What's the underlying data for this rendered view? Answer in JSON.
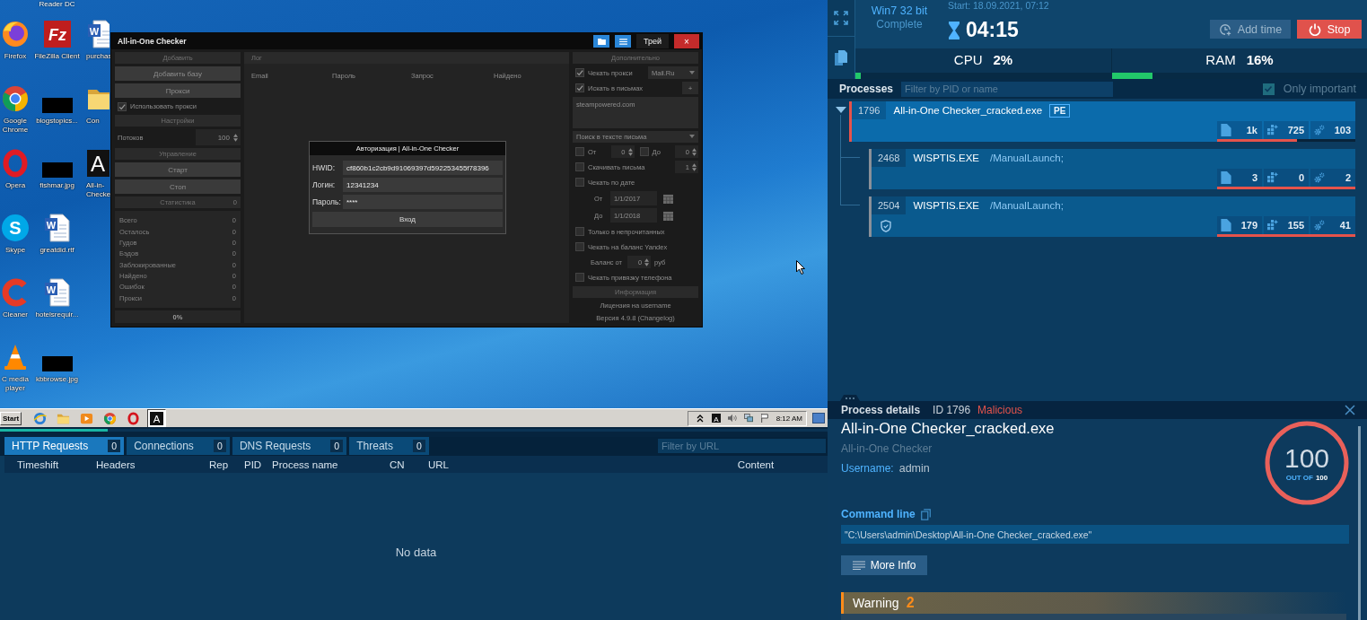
{
  "desktop": {
    "top_caption": "Reader DC",
    "columns": [
      [
        {
          "kind": "firefox",
          "lines": [
            "Firefox"
          ]
        },
        {
          "kind": "chrome",
          "lines": [
            "Google",
            "Chrome"
          ]
        },
        {
          "kind": "opera",
          "lines": [
            "Opera"
          ]
        },
        {
          "kind": "skype",
          "glyph": "S",
          "lines": [
            "Skype"
          ]
        },
        {
          "kind": "ccleaner",
          "lines": [
            "Cleaner"
          ]
        },
        {
          "kind": "vlc",
          "lines": [
            "C media",
            "player"
          ]
        }
      ],
      [
        {
          "kind": "filezilla",
          "glyph": "Fz",
          "lines": [
            "FileZilla Client"
          ]
        },
        {
          "kind": "redacted",
          "lines": [
            "blogstopics..."
          ]
        },
        {
          "kind": "redacted",
          "lines": [
            "fishmar.jpg"
          ]
        },
        {
          "kind": "word",
          "glyph": "W",
          "lines": [
            "greatdid.rtf"
          ]
        },
        {
          "kind": "word",
          "glyph": "W",
          "lines": [
            "hotelsrequir..."
          ]
        },
        {
          "kind": "redacted",
          "lines": [
            "kbbrowse.jpg"
          ]
        }
      ],
      [
        {
          "kind": "word",
          "glyph": "W",
          "lines": [
            "purchas"
          ]
        },
        {
          "kind": "folder",
          "lines": [
            "Con"
          ]
        },
        {
          "kind": "app",
          "glyph": "A",
          "lines": [
            "All-in-",
            "Checke"
          ]
        }
      ]
    ]
  },
  "checker_window": {
    "title": "All-in-One Checker",
    "title_buttons": [
      {
        "kind": "folder"
      },
      {
        "kind": "menu"
      },
      {
        "kind": "text",
        "label": "Трей"
      },
      {
        "kind": "close",
        "label": "×"
      }
    ],
    "left_panel": {
      "sections": [
        {
          "kind": "list",
          "title": "Добавить",
          "items": [
            {
              "kind": "button",
              "label": "Добавить базу"
            },
            {
              "kind": "button",
              "label": "Прокси"
            },
            {
              "kind": "checkbox",
              "label": "Использовать прокси",
              "checked": true
            }
          ]
        },
        {
          "kind": "list",
          "title": "Настройки",
          "items": [
            {
              "kind": "spinner",
              "label": "Потоков",
              "value": "100"
            }
          ]
        },
        {
          "kind": "list",
          "title": "Управление",
          "items": [
            {
              "kind": "button",
              "label": "Старт"
            },
            {
              "kind": "button",
              "label": "Стоп"
            }
          ]
        },
        {
          "kind": "stats",
          "title": "Статистика",
          "badge": "0",
          "items": [
            {
              "kind": "stat",
              "label": "Всего",
              "value": "0"
            },
            {
              "kind": "stat",
              "label": "Осталось",
              "value": "0"
            },
            {
              "kind": "stat",
              "label": "Гудов",
              "value": "0"
            },
            {
              "kind": "stat",
              "label": "Бэдов",
              "value": "0"
            },
            {
              "kind": "stat",
              "label": "Заблокированные",
              "value": "0"
            },
            {
              "kind": "stat",
              "label": "Найдено",
              "value": "0"
            },
            {
              "kind": "stat",
              "label": "Ошибок",
              "value": "0"
            },
            {
              "kind": "stat",
              "label": "Прокси",
              "value": "0"
            }
          ]
        }
      ],
      "percent": "0%"
    },
    "log": {
      "title": "Лог",
      "columns": [
        "Email",
        "Пароль",
        "Запрос",
        "Найдено"
      ]
    },
    "options": {
      "title": "Дополнительно",
      "rows": [
        {
          "kind": "check-select",
          "label": "Чекать прокси",
          "checked": true,
          "value": "Mail.Ru"
        },
        {
          "kind": "check-button",
          "label": "Искать в письмах",
          "checked": true,
          "button": "+"
        },
        {
          "kind": "textarea",
          "value": "steampowered.com"
        },
        {
          "kind": "select",
          "value": "Поиск в тексте письма"
        },
        {
          "kind": "range",
          "items": [
            {
              "label": "От",
              "checked": false,
              "value": "0"
            },
            {
              "label": "До",
              "checked": false,
              "value": "0"
            }
          ]
        },
        {
          "kind": "check-spinner",
          "label": "Скачивать письма",
          "checked": false,
          "value": "1"
        },
        {
          "kind": "checkbox",
          "label": "Чекать по дате",
          "checked": false
        },
        {
          "kind": "date",
          "label": "От",
          "value": "1/1/2017"
        },
        {
          "kind": "date",
          "label": "До",
          "value": "1/1/2018"
        },
        {
          "kind": "checkbox",
          "label": "Только в непрочитанных",
          "checked": false
        },
        {
          "kind": "checkbox",
          "label": "Чекать на баланс Yandex",
          "checked": false
        },
        {
          "kind": "spinner",
          "label": "Баланс от",
          "value": "0",
          "unit": "руб"
        },
        {
          "kind": "checkbox",
          "label": "Чекать привязку телефона",
          "checked": false
        }
      ],
      "info_title": "Информация",
      "info_lines": [
        "Лицензия на username",
        "Версия 4.9.8 (Changelog)"
      ]
    },
    "auth_dialog": {
      "title": "Авторизация | All-in-One Checker",
      "fields": [
        {
          "label": "HWID:",
          "value": "cf860b1c2cb9d91069397d592253455f78396"
        },
        {
          "label": "Логин:",
          "value": "12341234"
        },
        {
          "label": "Пароль:",
          "value": "****"
        }
      ],
      "button": "Вход"
    }
  },
  "taskbar": {
    "start": "Start",
    "apps": [
      {
        "kind": "ie",
        "selected": false
      },
      {
        "kind": "explorer",
        "selected": false
      },
      {
        "kind": "media",
        "selected": false
      },
      {
        "kind": "chrome",
        "selected": false
      },
      {
        "kind": "opera",
        "selected": false
      },
      {
        "kind": "app",
        "glyph": "A",
        "selected": true
      }
    ],
    "tray_app": {
      "glyph": "A"
    },
    "clock": "8:12 AM"
  },
  "playback": {
    "level": 0.13
  },
  "network": {
    "tabs": [
      {
        "label": "HTTP Requests",
        "count": "0",
        "selected": true
      },
      {
        "label": "Connections",
        "count": "0",
        "selected": false
      },
      {
        "label": "DNS Requests",
        "count": "0",
        "selected": false
      },
      {
        "label": "Threats",
        "count": "0",
        "selected": false
      }
    ],
    "filter": {
      "placeholder": "Filter by URL"
    },
    "columns": [
      "Timeshift",
      "Headers",
      "Rep",
      "PID",
      "Process name",
      "CN",
      "URL",
      "Content"
    ],
    "empty": "No data"
  },
  "session": {
    "os": "Win7 32 bit",
    "status": "Complete",
    "start": "Start: 18.09.2021, 07:12",
    "timer": "04:15",
    "buttons": [
      {
        "kind": "add-time",
        "label": "Add time"
      },
      {
        "kind": "stop",
        "label": "Stop"
      }
    ]
  },
  "resources": [
    {
      "label": "CPU",
      "value": "2%",
      "level": 0.02
    },
    {
      "label": "RAM",
      "value": "16%",
      "level": 0.16
    }
  ],
  "processes": {
    "title": "Processes",
    "filter": {
      "placeholder": "Filter by PID or name"
    },
    "only_important": {
      "label": "Only important",
      "checked": true
    },
    "tree": [
      {
        "pid": "1796",
        "name": "All-in-One Checker_cracked.exe",
        "badge": "PE",
        "selected": true,
        "expanded": true,
        "shield": false,
        "color": "#e5534b",
        "stats": [
          {
            "kind": "files",
            "value": "1k"
          },
          {
            "kind": "registry",
            "value": "725"
          },
          {
            "kind": "modules",
            "value": "103"
          }
        ],
        "level": 0.58,
        "children": [
          {
            "pid": "2468",
            "name": "WISPTIS.EXE",
            "args": "/ManualLaunch;",
            "selected": false,
            "shield": false,
            "color": "#8a9099",
            "stats": [
              {
                "kind": "files",
                "value": "3"
              },
              {
                "kind": "registry",
                "value": "0"
              },
              {
                "kind": "modules",
                "value": "2"
              }
            ],
            "level": 1
          },
          {
            "pid": "2504",
            "name": "WISPTIS.EXE",
            "args": "/ManualLaunch;",
            "selected": false,
            "shield": true,
            "color": "#8a9099",
            "stats": [
              {
                "kind": "files",
                "value": "179"
              },
              {
                "kind": "registry",
                "value": "155"
              },
              {
                "kind": "modules",
                "value": "41"
              }
            ],
            "level": 1
          }
        ]
      }
    ]
  },
  "details": {
    "title": "Process details",
    "id": "ID 1796",
    "verdict": "Malicious",
    "name": "All-in-One Checker_cracked.exe",
    "description": "All-in-One Checker",
    "username_label": "Username:",
    "username": "admin",
    "score": {
      "value": "100",
      "caption": "OUT OF",
      "max": "100",
      "level": 1
    },
    "command_label": "Command line",
    "command": "\"C:\\Users\\admin\\Desktop\\All-in-One Checker_cracked.exe\"",
    "more_info": "More Info",
    "warning": {
      "label": "Warning",
      "count": "2"
    }
  }
}
